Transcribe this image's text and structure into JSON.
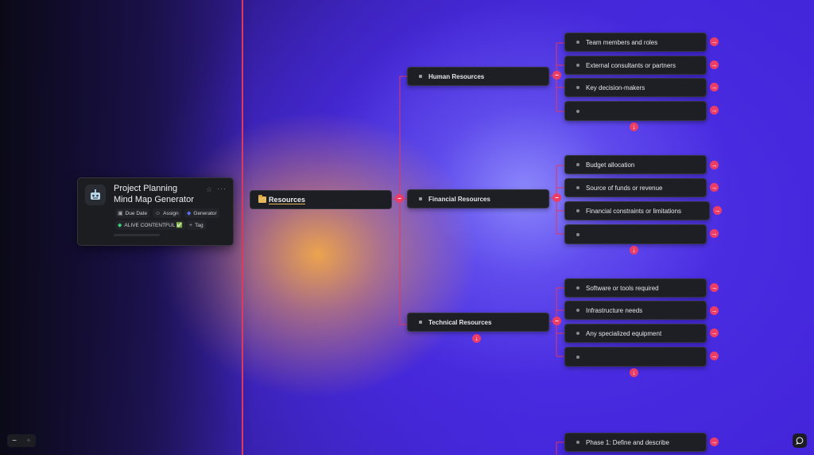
{
  "card": {
    "title_line1": "Project Planning",
    "title_line2": "Mind Map Generator",
    "avatar_icon": "robot-icon",
    "more": "···",
    "chips": {
      "due_date": "Due Date",
      "assign": "Assign",
      "generator": "Generator",
      "status": "ALIVE CONTENTFUL ✅",
      "tag": "Tag"
    }
  },
  "root": {
    "label": "Resources",
    "icon": "folder-icon"
  },
  "categories": [
    {
      "label": "Human Resources",
      "items": [
        "Team members and roles",
        "External consultants or partners",
        "Key decision-makers",
        ""
      ]
    },
    {
      "label": "Financial Resources",
      "items": [
        "Budget allocation",
        "Source of funds or revenue",
        "Financial constraints or limitations",
        ""
      ]
    },
    {
      "label": "Technical Resources",
      "items": [
        "Software or tools required",
        "Infrastructure needs",
        "Any specialized equipment",
        ""
      ]
    }
  ],
  "next_section": {
    "item": "Phase 1: Define and describe"
  },
  "zoom": {
    "minus": "−",
    "plus": "+"
  },
  "colors": {
    "accent": "#ea3d67",
    "node_bg": "#1e1f24",
    "folder": "#e8b95a"
  }
}
